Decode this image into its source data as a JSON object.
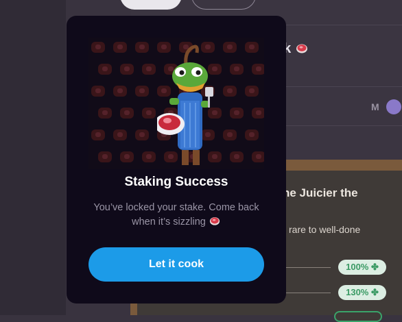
{
  "background": {
    "title_fragment": "ak",
    "title_icon": "meat-icon",
    "user_initial": "M",
    "board_title": "he Juicier the",
    "board_subtitle": "rare to well-done",
    "multipliers": [
      "100%",
      "130%"
    ],
    "multiplier_icon": "clover-icon"
  },
  "modal": {
    "title": "Staking Success",
    "message": "You’ve locked your stake. Come back when it’s sizzling",
    "message_icon": "meat-icon",
    "cta_label": "Let it cook",
    "art_icon": "frog-chef-icon"
  },
  "colors": {
    "accent": "#1c9be8",
    "modal_bg": "#0f0a1a",
    "success": "#3a9a64"
  }
}
